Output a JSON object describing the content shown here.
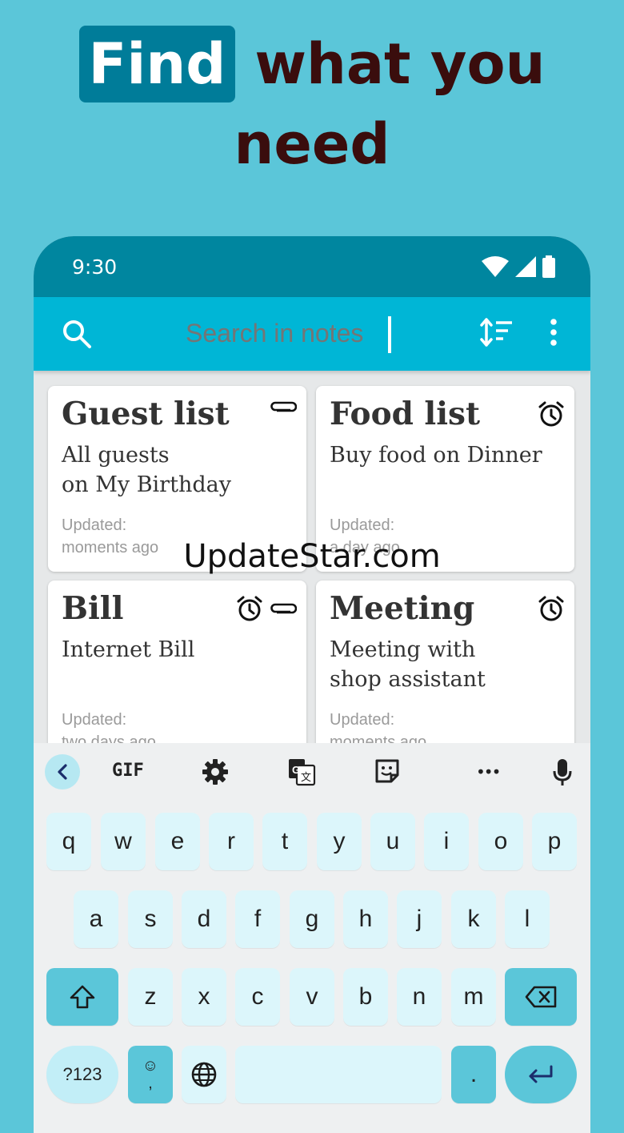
{
  "headline": {
    "highlight": "Find",
    "line1_rest": "what you",
    "line2": "need"
  },
  "status_bar": {
    "time": "9:30"
  },
  "app_bar": {
    "search_placeholder": "Search in notes"
  },
  "notes": [
    {
      "title": "Guest list",
      "body": "All guests\non My Birthday",
      "updated_label": "Updated:",
      "updated_value": "moments ago",
      "icons": [
        "paperclip-icon"
      ]
    },
    {
      "title": "Food list",
      "body": "Buy food on Dinner",
      "updated_label": "Updated:",
      "updated_value": "a day ago",
      "icons": [
        "alarm-icon"
      ]
    },
    {
      "title": "Bill",
      "body": "Internet Bill",
      "updated_label": "Updated:",
      "updated_value": "two days ago",
      "icons": [
        "alarm-icon",
        "paperclip-icon"
      ]
    },
    {
      "title": "Meeting",
      "body": "Meeting with\nshop assistant",
      "updated_label": "Updated:",
      "updated_value": "moments ago",
      "icons": [
        "alarm-icon"
      ]
    }
  ],
  "keyboard": {
    "toolbar": {
      "gif_label": "GIF",
      "more_label": "•••"
    },
    "row1": [
      "q",
      "w",
      "e",
      "r",
      "t",
      "y",
      "u",
      "i",
      "o",
      "p"
    ],
    "row2": [
      "a",
      "s",
      "d",
      "f",
      "g",
      "h",
      "j",
      "k",
      "l"
    ],
    "row3": [
      "z",
      "x",
      "c",
      "v",
      "b",
      "n",
      "m"
    ],
    "symbols_label": "?123",
    "emoji_comma_label": "☺\n,",
    "period_label": "."
  },
  "watermark": "UpdateStar.com",
  "colors": {
    "background": "#5bc6d9",
    "status_bar": "#00869f",
    "app_bar": "#00b6d6",
    "highlight": "#007c99",
    "headline_text": "#3a0d0d",
    "key": "#dcf6fb"
  }
}
